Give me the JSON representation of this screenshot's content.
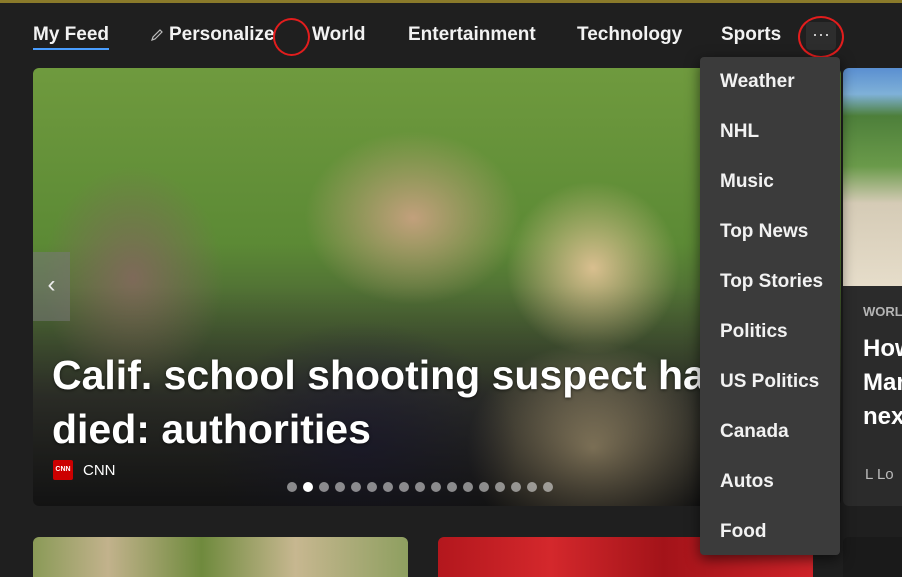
{
  "nav": {
    "my_feed": "My Feed",
    "personalize": "Personalize",
    "world": "World",
    "entertainment": "Entertainment",
    "technology": "Technology",
    "sports": "Sports",
    "more": "···"
  },
  "hero": {
    "headline_line1": "Calif. school shooting suspect has",
    "headline_line2": "died: authorities",
    "source": "CNN",
    "source_logo_text": "CNN",
    "prev_arrow": "‹",
    "carousel_total": 17,
    "carousel_active": 2
  },
  "right_card": {
    "kicker": "WORL",
    "title_line1": "How",
    "title_line2": "Mar",
    "title_line3": "nex",
    "source": "L Lo"
  },
  "dropdown": {
    "items": [
      "Weather",
      "NHL",
      "Music",
      "Top News",
      "Top Stories",
      "Politics",
      "US Politics",
      "Canada",
      "Autos",
      "Food"
    ]
  },
  "colors": {
    "background": "#1f1f1f",
    "accent": "#4a9eff",
    "annotation_red": "#e21d1d",
    "dropdown_bg": "#3b3b3b"
  }
}
